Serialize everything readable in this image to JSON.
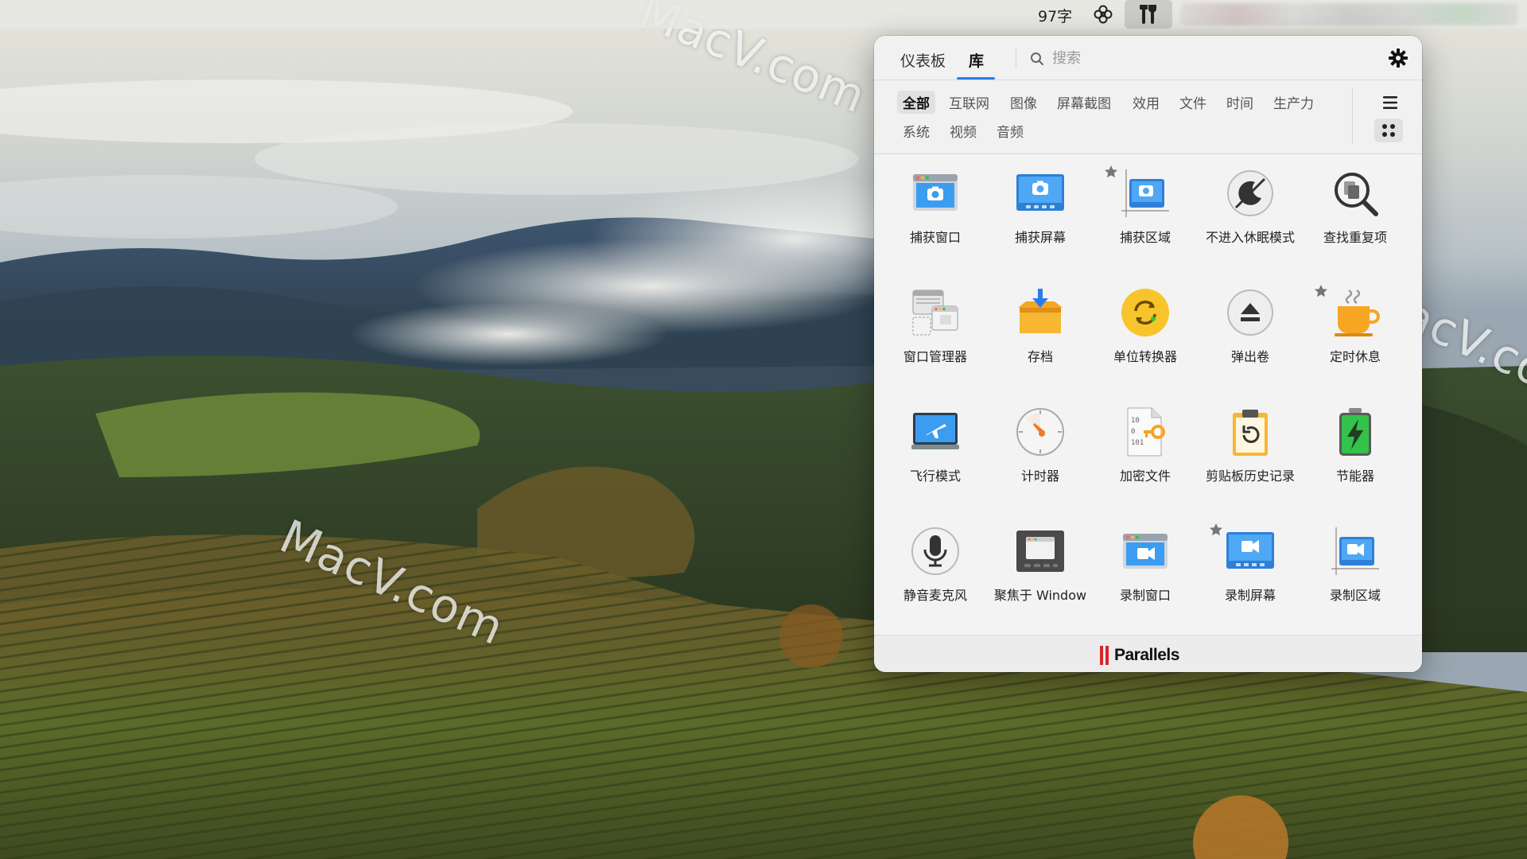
{
  "menubar": {
    "word_count": "97字",
    "icons": [
      "flower-icon",
      "tools-icon"
    ]
  },
  "panel": {
    "tabs": [
      {
        "label": "仪表板",
        "active": false
      },
      {
        "label": "库",
        "active": true
      }
    ],
    "search": {
      "placeholder": "搜索",
      "value": ""
    },
    "accent": "#2b7bf0",
    "categories": [
      {
        "label": "全部",
        "active": true
      },
      {
        "label": "互联网"
      },
      {
        "label": "图像"
      },
      {
        "label": "屏幕截图"
      },
      {
        "label": "效用"
      },
      {
        "label": "文件"
      },
      {
        "label": "时间"
      },
      {
        "label": "生产力"
      },
      {
        "label": "系统"
      },
      {
        "label": "视频"
      },
      {
        "label": "音频"
      }
    ],
    "tools": [
      {
        "label": "捕获窗口",
        "icon": "capture-window-icon",
        "starred": false
      },
      {
        "label": "捕获屏幕",
        "icon": "capture-screen-icon",
        "starred": false
      },
      {
        "label": "捕获区域",
        "icon": "capture-area-icon",
        "starred": true
      },
      {
        "label": "不进入休眠模式",
        "icon": "no-sleep-icon",
        "starred": false
      },
      {
        "label": "查找重复项",
        "icon": "find-duplicates-icon",
        "starred": false
      },
      {
        "label": "窗口管理器",
        "icon": "window-manager-icon",
        "starred": false
      },
      {
        "label": "存档",
        "icon": "archive-icon",
        "starred": false
      },
      {
        "label": "单位转换器",
        "icon": "unit-converter-icon",
        "starred": false
      },
      {
        "label": "弹出卷",
        "icon": "eject-volume-icon",
        "starred": false
      },
      {
        "label": "定时休息",
        "icon": "take-break-icon",
        "starred": true
      },
      {
        "label": "飞行模式",
        "icon": "airplane-mode-icon",
        "starred": false
      },
      {
        "label": "计时器",
        "icon": "timer-icon",
        "starred": false
      },
      {
        "label": "加密文件",
        "icon": "encrypt-file-icon",
        "starred": false
      },
      {
        "label": "剪贴板历史记录",
        "icon": "clipboard-history-icon",
        "starred": false
      },
      {
        "label": "节能器",
        "icon": "energy-saver-icon",
        "starred": false
      },
      {
        "label": "静音麦克风",
        "icon": "mute-microphone-icon",
        "starred": false
      },
      {
        "label": "聚焦于 Window",
        "icon": "focus-window-icon",
        "starred": false
      },
      {
        "label": "录制窗口",
        "icon": "record-window-icon",
        "starred": false
      },
      {
        "label": "录制屏幕",
        "icon": "record-screen-icon",
        "starred": true
      },
      {
        "label": "录制区域",
        "icon": "record-area-icon",
        "starred": false
      }
    ],
    "brand": "Parallels",
    "brand_color": "#d6262c"
  },
  "watermarks": [
    "MacV.com",
    "MacV.com",
    "MacV.co"
  ]
}
